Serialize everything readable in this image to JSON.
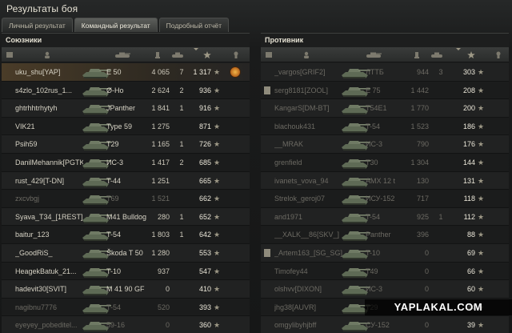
{
  "window": {
    "title": "Результаты боя"
  },
  "tabs": [
    {
      "label": "Личный результат",
      "active": false
    },
    {
      "label": "Командный результат",
      "active": true
    },
    {
      "label": "Подробный отчёт",
      "active": false
    }
  ],
  "allies": {
    "title": "Союзники",
    "columns": [
      "squad-icon",
      "player-icon",
      "vehicle-icon",
      "damage-icon",
      "kills-icon",
      "sort-arrow-icon",
      "experience-star-icon",
      "medal-icon"
    ],
    "rows": [
      {
        "name": "uku_shu[YAP]",
        "tank": "E 50",
        "damage": "4 065",
        "kills": "7",
        "xp": "1 317",
        "me": true,
        "dead": false,
        "medal": true
      },
      {
        "name": "s4zlo_102rus_1...",
        "tank": "Ø-Ho",
        "damage": "2 624",
        "kills": "2",
        "xp": "936",
        "me": false,
        "dead": false,
        "medal": false
      },
      {
        "name": "ghtrhhtrhytyh",
        "tank": "JPanther",
        "damage": "1 841",
        "kills": "1",
        "xp": "916",
        "me": false,
        "dead": false,
        "medal": false
      },
      {
        "name": "VIK21",
        "tank": "Type 59",
        "damage": "1 275",
        "kills": "",
        "xp": "871",
        "me": false,
        "dead": false,
        "medal": false
      },
      {
        "name": "Psih59",
        "tank": "T29",
        "damage": "1 165",
        "kills": "1",
        "xp": "726",
        "me": false,
        "dead": false,
        "medal": false
      },
      {
        "name": "DanilMehannik[PGTK]",
        "tank": "ИС-3",
        "damage": "1 417",
        "kills": "2",
        "xp": "685",
        "me": false,
        "dead": false,
        "medal": false
      },
      {
        "name": "rust_429[T-DN]",
        "tank": "T-44",
        "damage": "1 251",
        "kills": "",
        "xp": "665",
        "me": false,
        "dead": false,
        "medal": false
      },
      {
        "name": "zxcvbgj",
        "tank": "T69",
        "damage": "1 521",
        "kills": "",
        "xp": "662",
        "me": false,
        "dead": true,
        "medal": false
      },
      {
        "name": "Syava_T34_[1REST]",
        "tank": "M41 Bulldog",
        "damage": "280",
        "kills": "1",
        "xp": "652",
        "me": false,
        "dead": false,
        "medal": false
      },
      {
        "name": "baitur_123",
        "tank": "T-54",
        "damage": "1 803",
        "kills": "1",
        "xp": "642",
        "me": false,
        "dead": false,
        "medal": false
      },
      {
        "name": "_GoodRiS_",
        "tank": "Škoda T 50",
        "damage": "1 280",
        "kills": "",
        "xp": "553",
        "me": false,
        "dead": false,
        "medal": false
      },
      {
        "name": "HeagekBatuk_21...",
        "tank": "T-10",
        "damage": "937",
        "kills": "",
        "xp": "547",
        "me": false,
        "dead": false,
        "medal": false
      },
      {
        "name": "hadevit30[SVIT]",
        "tank": "M 41 90 GF",
        "damage": "0",
        "kills": "",
        "xp": "410",
        "me": false,
        "dead": false,
        "medal": false
      },
      {
        "name": "nagibnu7776",
        "tank": "T-54",
        "damage": "520",
        "kills": "",
        "xp": "393",
        "me": false,
        "dead": true,
        "medal": false
      },
      {
        "name": "eyeyey_pobeditel...",
        "tank": "59-16",
        "damage": "0",
        "kills": "",
        "xp": "360",
        "me": false,
        "dead": true,
        "medal": false
      }
    ]
  },
  "enemies": {
    "title": "Противник",
    "columns": [
      "squad-icon",
      "player-icon",
      "vehicle-icon",
      "damage-icon",
      "kills-icon",
      "sort-arrow-icon",
      "experience-star-icon",
      "medal-icon"
    ],
    "rows": [
      {
        "name": "_vargos[GRIF2]",
        "tank": "ЛТТБ",
        "damage": "944",
        "kills": "3",
        "xp": "303",
        "squad": false,
        "dead": true
      },
      {
        "name": "serg8181[ZOOL]",
        "tank": "E 75",
        "damage": "1 442",
        "kills": "",
        "xp": "208",
        "squad": true,
        "dead": true
      },
      {
        "name": "KangarS[DM-BT]",
        "tank": "T54E1",
        "damage": "1 770",
        "kills": "",
        "xp": "200",
        "squad": false,
        "dead": true
      },
      {
        "name": "blachouk431",
        "tank": "T-54",
        "damage": "1 523",
        "kills": "",
        "xp": "186",
        "squad": false,
        "dead": true
      },
      {
        "name": "__MRAK",
        "tank": "ИС-3",
        "damage": "790",
        "kills": "",
        "xp": "176",
        "squad": false,
        "dead": true
      },
      {
        "name": "grenfield",
        "tank": "T30",
        "damage": "1 304",
        "kills": "",
        "xp": "144",
        "squad": false,
        "dead": true
      },
      {
        "name": "ivanets_vova_94",
        "tank": "AMX 12 t",
        "damage": "130",
        "kills": "",
        "xp": "131",
        "squad": false,
        "dead": true
      },
      {
        "name": "Strelok_geroj07",
        "tank": "ИСУ-152",
        "damage": "717",
        "kills": "",
        "xp": "118",
        "squad": false,
        "dead": true
      },
      {
        "name": "and1971",
        "tank": "T-54",
        "damage": "925",
        "kills": "1",
        "xp": "112",
        "squad": false,
        "dead": true
      },
      {
        "name": "__XALK__86[SKV_]",
        "tank": "Panther",
        "damage": "396",
        "kills": "",
        "xp": "88",
        "squad": false,
        "dead": true
      },
      {
        "name": "_Artem163_[SG_SG]",
        "tank": "T-10",
        "damage": "0",
        "kills": "",
        "xp": "69",
        "squad": true,
        "dead": true
      },
      {
        "name": "Timofey44",
        "tank": "T49",
        "damage": "0",
        "kills": "",
        "xp": "66",
        "squad": false,
        "dead": true
      },
      {
        "name": "olshvv[DIXON]",
        "tank": "ИС-3",
        "damage": "0",
        "kills": "",
        "xp": "60",
        "squad": false,
        "dead": true
      },
      {
        "name": "jhg38[AUVR]",
        "tank": "T29",
        "damage": "0",
        "kills": "",
        "xp": "44",
        "squad": false,
        "dead": true
      },
      {
        "name": "omgylibyhjbff",
        "tank": "СУ-152",
        "damage": "0",
        "kills": "",
        "xp": "39",
        "squad": false,
        "dead": true
      }
    ]
  },
  "watermark": "YAPLAKAL.COM",
  "colors": {
    "accent": "#f2b64a",
    "highlight_row": "#4a3c28",
    "background": "#1d1e1e"
  }
}
